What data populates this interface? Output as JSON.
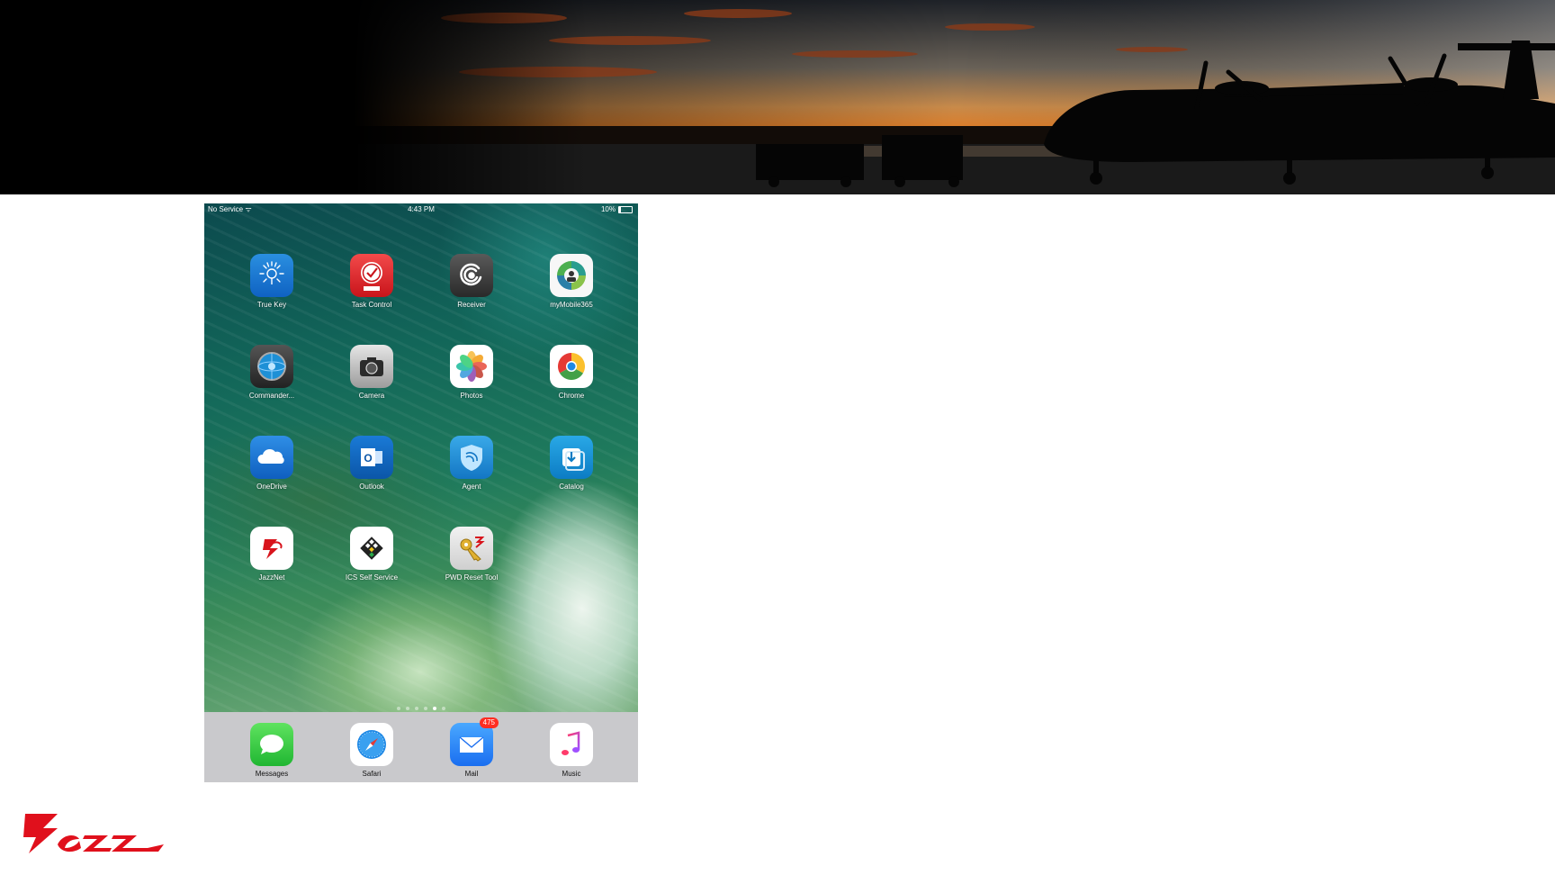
{
  "status_bar": {
    "carrier": "No Service",
    "time": "4:43 PM",
    "battery": "10%"
  },
  "apps": [
    {
      "label": "True Key",
      "icon": "true-key-icon"
    },
    {
      "label": "Task Control",
      "icon": "task-control-icon"
    },
    {
      "label": "Receiver",
      "icon": "receiver-icon"
    },
    {
      "label": "myMobile365",
      "icon": "mymobile365-icon"
    },
    {
      "label": "Commander...",
      "icon": "commander-icon"
    },
    {
      "label": "Camera",
      "icon": "camera-icon"
    },
    {
      "label": "Photos",
      "icon": "photos-icon"
    },
    {
      "label": "Chrome",
      "icon": "chrome-icon"
    },
    {
      "label": "OneDrive",
      "icon": "onedrive-icon"
    },
    {
      "label": "Outlook",
      "icon": "outlook-icon"
    },
    {
      "label": "Agent",
      "icon": "agent-icon"
    },
    {
      "label": "Catalog",
      "icon": "catalog-icon"
    },
    {
      "label": "JazzNet",
      "icon": "jazznet-icon"
    },
    {
      "label": "ICS Self Service",
      "icon": "ics-self-service-icon"
    },
    {
      "label": "PWD Reset Tool",
      "icon": "pwd-reset-tool-icon"
    }
  ],
  "dock": [
    {
      "label": "Messages",
      "icon": "messages-icon"
    },
    {
      "label": "Safari",
      "icon": "safari-icon"
    },
    {
      "label": "Mail",
      "icon": "mail-icon",
      "badge": "475"
    },
    {
      "label": "Music",
      "icon": "music-icon"
    }
  ],
  "logo": "Jazz",
  "colors": {
    "brand_red": "#e0101c",
    "dock_bg": "#c9c9cc"
  }
}
